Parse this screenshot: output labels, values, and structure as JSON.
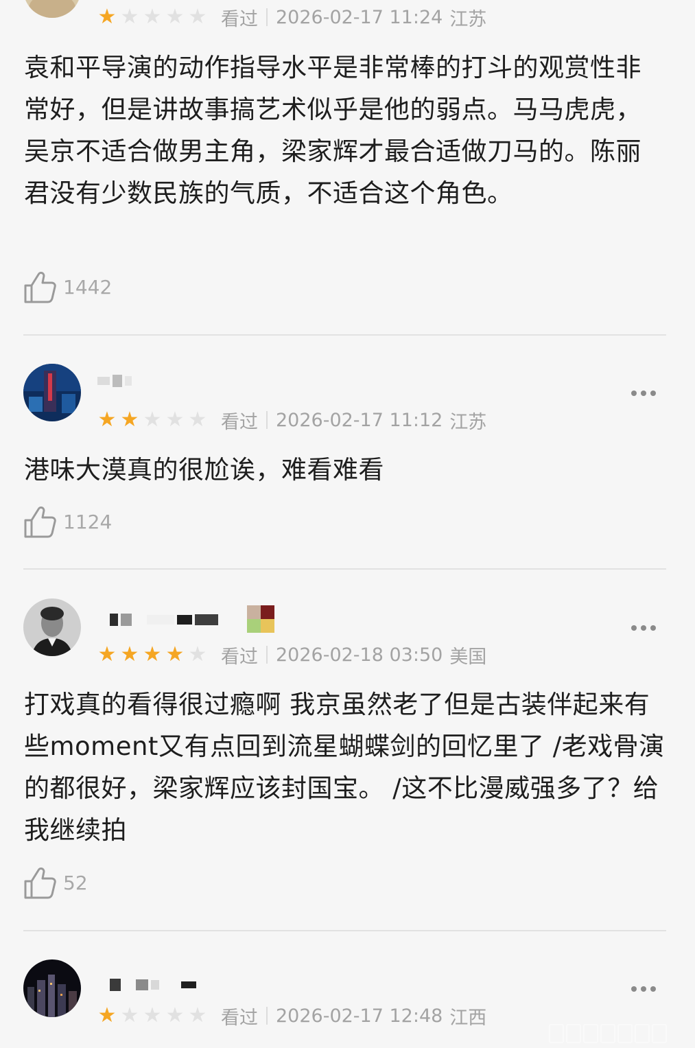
{
  "reviews": [
    {
      "rating": 1,
      "watched_label": "看过",
      "time": "2026-02-17 11:24",
      "location": "江苏",
      "content": "袁和平导演的动作指导水平是非常棒的打斗的观赏性非常好，但是讲故事搞艺术似乎是他的弱点。马马虎虎，吴京不适合做男主角，梁家辉才最合适做刀马的。陈丽君没有少数民族的气质，不适合这个角色。",
      "likes": "1442"
    },
    {
      "rating": 2,
      "watched_label": "看过",
      "time": "2026-02-17 11:12",
      "location": "江苏",
      "content": "港味大漠真的很尬诶，难看难看",
      "likes": "1124"
    },
    {
      "rating": 4,
      "watched_label": "看过",
      "time": "2026-02-18 03:50",
      "location": "美国",
      "content": "打戏真的看得很过瘾啊 我京虽然老了但是古装伴起来有些moment又有点回到流星蝴蝶剑的回忆里了 /老戏骨演的都很好，梁家辉应该封国宝。 /这不比漫威强多了？给我继续拍",
      "likes": "52"
    },
    {
      "rating": 1,
      "watched_label": "看过",
      "time": "2026-02-17 12:48",
      "location": "江西"
    }
  ],
  "colors": {
    "star_on": "#f5a623",
    "star_off": "#e1e1e1",
    "meta_text": "#a3a3a3",
    "background": "#f6f6f6"
  },
  "icons": {
    "like": "thumbs-up-icon",
    "more": "more-icon",
    "star": "star-icon"
  }
}
